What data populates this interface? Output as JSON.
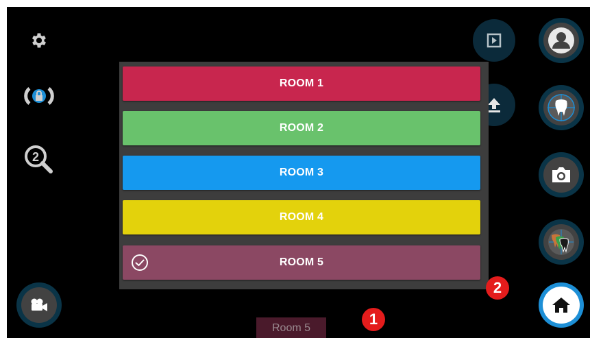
{
  "rooms": [
    {
      "label": "ROOM 1",
      "color": "#c8264e",
      "selected": false
    },
    {
      "label": "ROOM 2",
      "color": "#69c26c",
      "selected": false
    },
    {
      "label": "ROOM 3",
      "color": "#1599ef",
      "selected": false
    },
    {
      "label": "ROOM 4",
      "color": "#e3d20c",
      "selected": false
    },
    {
      "label": "ROOM 5",
      "color": "#8b4863",
      "selected": true
    }
  ],
  "current_room_label": "Room 5",
  "badges": {
    "one": "1",
    "two": "2"
  },
  "icons": {
    "left": [
      "gear-icon",
      "lock-rotate-icon",
      "zoom-2-icon",
      "video-camera-icon"
    ],
    "right_small": [
      "play-icon",
      "upload-icon"
    ],
    "right_big": [
      "person-icon",
      "tooth-crosshair-icon",
      "camera-icon",
      "teeth-layers-icon",
      "home-icon"
    ]
  },
  "colors": {
    "accent": "#1d8fd6",
    "badge": "#e41c1c"
  }
}
